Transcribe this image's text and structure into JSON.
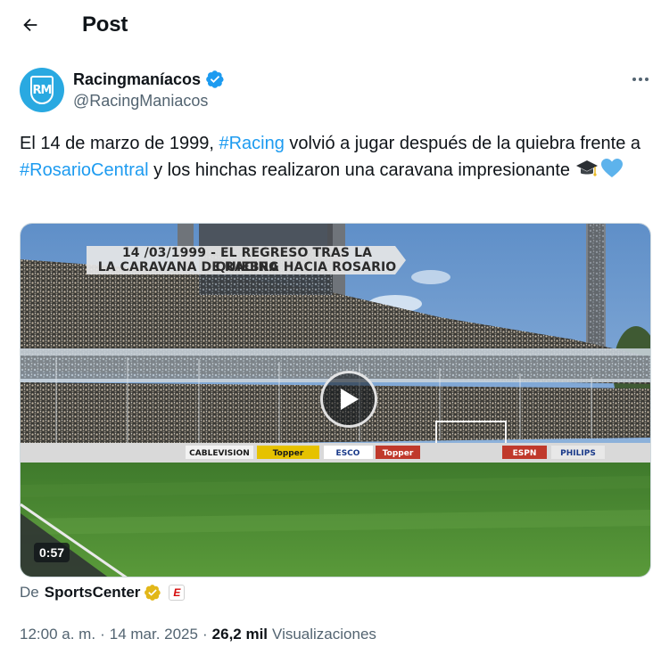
{
  "header": {
    "title": "Post",
    "back_icon": "arrow-left-icon"
  },
  "author": {
    "name": "Racingmaníacos",
    "handle": "@RacingManiacos",
    "avatar_initials": "RM",
    "avatar_color": "#29a9e1",
    "verified": true,
    "verified_color": "#1d9bf0"
  },
  "tweet": {
    "segments": [
      {
        "text": "El 14 de marzo de 1999, ",
        "type": "text"
      },
      {
        "text": "#Racing",
        "type": "hashtag"
      },
      {
        "text": " volvió a jugar después de la quiebra frente a ",
        "type": "text"
      },
      {
        "text": "#RosarioCentral",
        "type": "hashtag"
      },
      {
        "text": " y los hinchas realizaron una caravana impresionante ",
        "type": "text"
      }
    ],
    "emojis": [
      "graduation-cap-icon",
      "light-blue-heart-icon"
    ],
    "hashtag_color": "#1d9bf0"
  },
  "media": {
    "banner_line1": "14 /03/1999 - EL REGRESO TRAS LA QUIEBRA",
    "banner_line2": "LA CARAVANA DE RACING HACIA ROSARIO",
    "duration": "0:57",
    "play_icon": "play-icon",
    "ad_boards": [
      "CABLEVISION",
      "Topper",
      "ESCO",
      "Topper",
      "ESPN",
      "PHILIPS"
    ]
  },
  "source": {
    "prefix": "De",
    "name": "SportsCenter",
    "badge": "gold-verified-icon",
    "logo": "espn-logo-icon",
    "logo_letter": "E"
  },
  "meta": {
    "time": "12:00 a. m.",
    "date": "14 mar. 2025",
    "views_count": "26,2 mil",
    "views_label": "Visualizaciones"
  },
  "colors": {
    "text": "#0f1419",
    "secondary": "#536471",
    "accent": "#1d9bf0",
    "gold": "#e2b719"
  }
}
